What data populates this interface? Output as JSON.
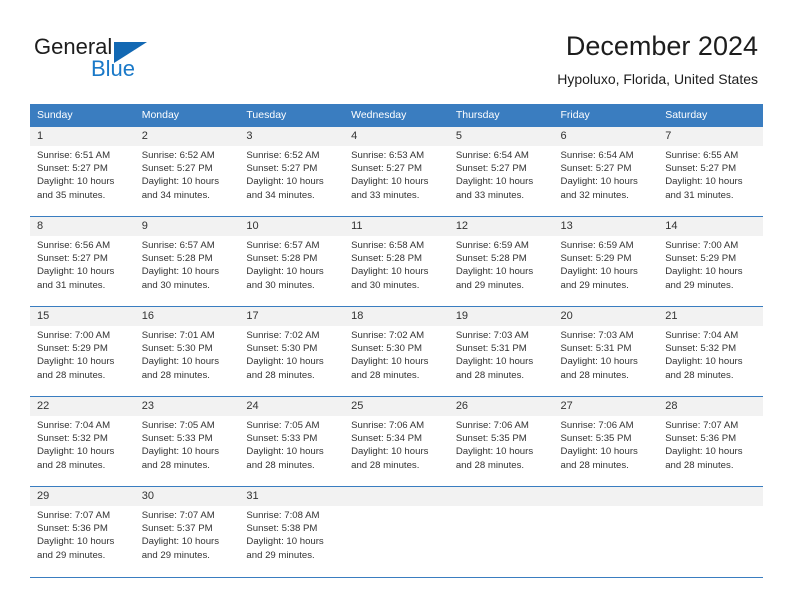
{
  "brand": {
    "name_top": "General",
    "name_bottom": "Blue",
    "triangle_icon": "triangle-logo-icon",
    "color_blue": "#1a79c8",
    "color_dark": "#1d1d1d"
  },
  "header": {
    "title": "December 2024",
    "subtitle": "Hypoluxo, Florida, United States"
  },
  "theme": {
    "header_row_bg": "#3a7dc0",
    "daynum_bg": "#f2f2f2",
    "border": "#3a7dc0",
    "text": "#333333"
  },
  "weekday_headers": [
    "Sunday",
    "Monday",
    "Tuesday",
    "Wednesday",
    "Thursday",
    "Friday",
    "Saturday"
  ],
  "weeks": [
    [
      {
        "day": "1",
        "sunrise": "Sunrise: 6:51 AM",
        "sunset": "Sunset: 5:27 PM",
        "daylight1": "Daylight: 10 hours",
        "daylight2": "and 35 minutes."
      },
      {
        "day": "2",
        "sunrise": "Sunrise: 6:52 AM",
        "sunset": "Sunset: 5:27 PM",
        "daylight1": "Daylight: 10 hours",
        "daylight2": "and 34 minutes."
      },
      {
        "day": "3",
        "sunrise": "Sunrise: 6:52 AM",
        "sunset": "Sunset: 5:27 PM",
        "daylight1": "Daylight: 10 hours",
        "daylight2": "and 34 minutes."
      },
      {
        "day": "4",
        "sunrise": "Sunrise: 6:53 AM",
        "sunset": "Sunset: 5:27 PM",
        "daylight1": "Daylight: 10 hours",
        "daylight2": "and 33 minutes."
      },
      {
        "day": "5",
        "sunrise": "Sunrise: 6:54 AM",
        "sunset": "Sunset: 5:27 PM",
        "daylight1": "Daylight: 10 hours",
        "daylight2": "and 33 minutes."
      },
      {
        "day": "6",
        "sunrise": "Sunrise: 6:54 AM",
        "sunset": "Sunset: 5:27 PM",
        "daylight1": "Daylight: 10 hours",
        "daylight2": "and 32 minutes."
      },
      {
        "day": "7",
        "sunrise": "Sunrise: 6:55 AM",
        "sunset": "Sunset: 5:27 PM",
        "daylight1": "Daylight: 10 hours",
        "daylight2": "and 31 minutes."
      }
    ],
    [
      {
        "day": "8",
        "sunrise": "Sunrise: 6:56 AM",
        "sunset": "Sunset: 5:27 PM",
        "daylight1": "Daylight: 10 hours",
        "daylight2": "and 31 minutes."
      },
      {
        "day": "9",
        "sunrise": "Sunrise: 6:57 AM",
        "sunset": "Sunset: 5:28 PM",
        "daylight1": "Daylight: 10 hours",
        "daylight2": "and 30 minutes."
      },
      {
        "day": "10",
        "sunrise": "Sunrise: 6:57 AM",
        "sunset": "Sunset: 5:28 PM",
        "daylight1": "Daylight: 10 hours",
        "daylight2": "and 30 minutes."
      },
      {
        "day": "11",
        "sunrise": "Sunrise: 6:58 AM",
        "sunset": "Sunset: 5:28 PM",
        "daylight1": "Daylight: 10 hours",
        "daylight2": "and 30 minutes."
      },
      {
        "day": "12",
        "sunrise": "Sunrise: 6:59 AM",
        "sunset": "Sunset: 5:28 PM",
        "daylight1": "Daylight: 10 hours",
        "daylight2": "and 29 minutes."
      },
      {
        "day": "13",
        "sunrise": "Sunrise: 6:59 AM",
        "sunset": "Sunset: 5:29 PM",
        "daylight1": "Daylight: 10 hours",
        "daylight2": "and 29 minutes."
      },
      {
        "day": "14",
        "sunrise": "Sunrise: 7:00 AM",
        "sunset": "Sunset: 5:29 PM",
        "daylight1": "Daylight: 10 hours",
        "daylight2": "and 29 minutes."
      }
    ],
    [
      {
        "day": "15",
        "sunrise": "Sunrise: 7:00 AM",
        "sunset": "Sunset: 5:29 PM",
        "daylight1": "Daylight: 10 hours",
        "daylight2": "and 28 minutes."
      },
      {
        "day": "16",
        "sunrise": "Sunrise: 7:01 AM",
        "sunset": "Sunset: 5:30 PM",
        "daylight1": "Daylight: 10 hours",
        "daylight2": "and 28 minutes."
      },
      {
        "day": "17",
        "sunrise": "Sunrise: 7:02 AM",
        "sunset": "Sunset: 5:30 PM",
        "daylight1": "Daylight: 10 hours",
        "daylight2": "and 28 minutes."
      },
      {
        "day": "18",
        "sunrise": "Sunrise: 7:02 AM",
        "sunset": "Sunset: 5:30 PM",
        "daylight1": "Daylight: 10 hours",
        "daylight2": "and 28 minutes."
      },
      {
        "day": "19",
        "sunrise": "Sunrise: 7:03 AM",
        "sunset": "Sunset: 5:31 PM",
        "daylight1": "Daylight: 10 hours",
        "daylight2": "and 28 minutes."
      },
      {
        "day": "20",
        "sunrise": "Sunrise: 7:03 AM",
        "sunset": "Sunset: 5:31 PM",
        "daylight1": "Daylight: 10 hours",
        "daylight2": "and 28 minutes."
      },
      {
        "day": "21",
        "sunrise": "Sunrise: 7:04 AM",
        "sunset": "Sunset: 5:32 PM",
        "daylight1": "Daylight: 10 hours",
        "daylight2": "and 28 minutes."
      }
    ],
    [
      {
        "day": "22",
        "sunrise": "Sunrise: 7:04 AM",
        "sunset": "Sunset: 5:32 PM",
        "daylight1": "Daylight: 10 hours",
        "daylight2": "and 28 minutes."
      },
      {
        "day": "23",
        "sunrise": "Sunrise: 7:05 AM",
        "sunset": "Sunset: 5:33 PM",
        "daylight1": "Daylight: 10 hours",
        "daylight2": "and 28 minutes."
      },
      {
        "day": "24",
        "sunrise": "Sunrise: 7:05 AM",
        "sunset": "Sunset: 5:33 PM",
        "daylight1": "Daylight: 10 hours",
        "daylight2": "and 28 minutes."
      },
      {
        "day": "25",
        "sunrise": "Sunrise: 7:06 AM",
        "sunset": "Sunset: 5:34 PM",
        "daylight1": "Daylight: 10 hours",
        "daylight2": "and 28 minutes."
      },
      {
        "day": "26",
        "sunrise": "Sunrise: 7:06 AM",
        "sunset": "Sunset: 5:35 PM",
        "daylight1": "Daylight: 10 hours",
        "daylight2": "and 28 minutes."
      },
      {
        "day": "27",
        "sunrise": "Sunrise: 7:06 AM",
        "sunset": "Sunset: 5:35 PM",
        "daylight1": "Daylight: 10 hours",
        "daylight2": "and 28 minutes."
      },
      {
        "day": "28",
        "sunrise": "Sunrise: 7:07 AM",
        "sunset": "Sunset: 5:36 PM",
        "daylight1": "Daylight: 10 hours",
        "daylight2": "and 28 minutes."
      }
    ],
    [
      {
        "day": "29",
        "sunrise": "Sunrise: 7:07 AM",
        "sunset": "Sunset: 5:36 PM",
        "daylight1": "Daylight: 10 hours",
        "daylight2": "and 29 minutes."
      },
      {
        "day": "30",
        "sunrise": "Sunrise: 7:07 AM",
        "sunset": "Sunset: 5:37 PM",
        "daylight1": "Daylight: 10 hours",
        "daylight2": "and 29 minutes."
      },
      {
        "day": "31",
        "sunrise": "Sunrise: 7:08 AM",
        "sunset": "Sunset: 5:38 PM",
        "daylight1": "Daylight: 10 hours",
        "daylight2": "and 29 minutes."
      },
      {
        "day": "",
        "sunrise": "",
        "sunset": "",
        "daylight1": "",
        "daylight2": ""
      },
      {
        "day": "",
        "sunrise": "",
        "sunset": "",
        "daylight1": "",
        "daylight2": ""
      },
      {
        "day": "",
        "sunrise": "",
        "sunset": "",
        "daylight1": "",
        "daylight2": ""
      },
      {
        "day": "",
        "sunrise": "",
        "sunset": "",
        "daylight1": "",
        "daylight2": ""
      }
    ]
  ]
}
